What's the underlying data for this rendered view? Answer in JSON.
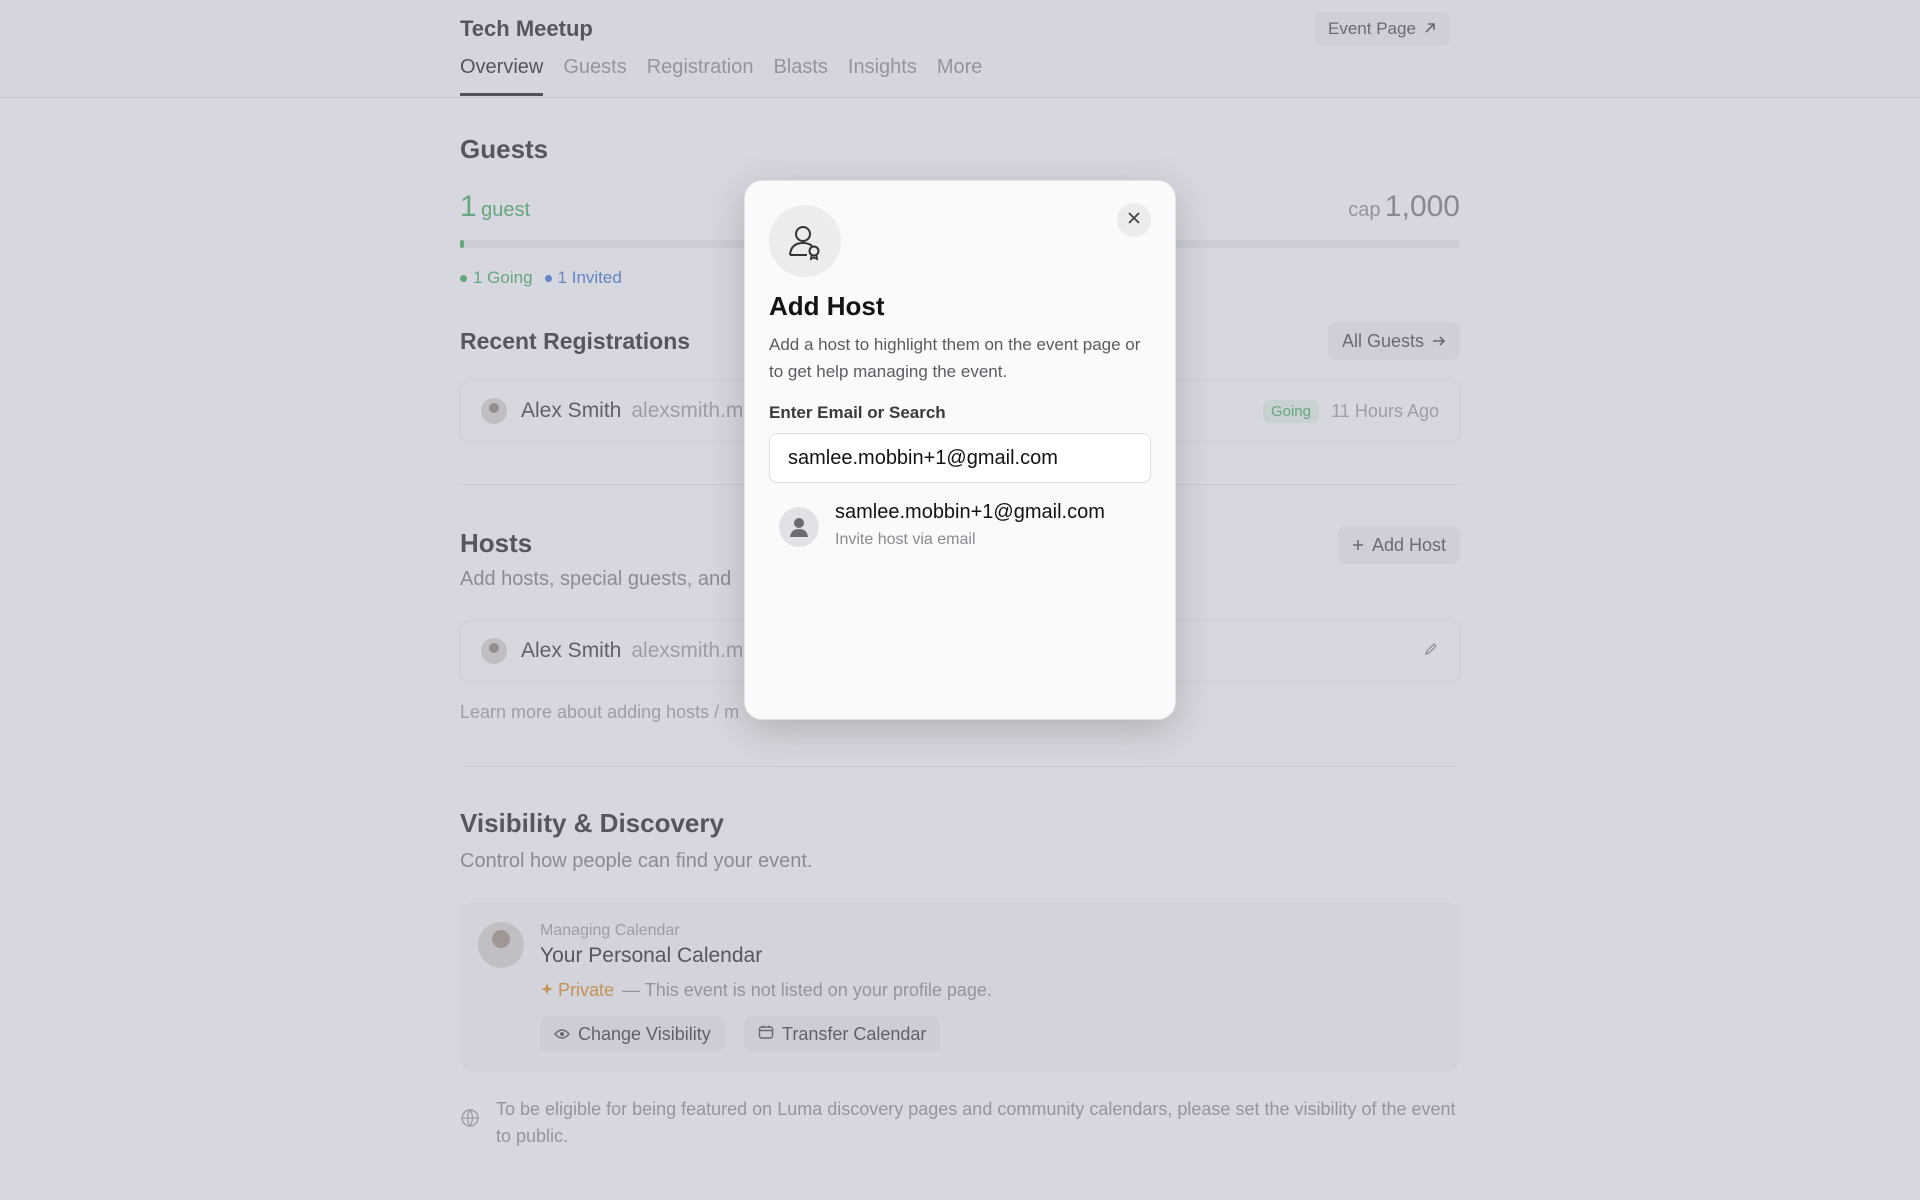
{
  "header": {
    "event_title": "Tech Meetup",
    "event_page_label": "Event Page",
    "tabs": [
      "Overview",
      "Guests",
      "Registration",
      "Blasts",
      "Insights",
      "More"
    ]
  },
  "guests": {
    "heading": "Guests",
    "count": "1",
    "count_label": "guest",
    "cap_label": "cap",
    "cap_value": "1,000",
    "progress_fraction": 0.001,
    "going": "1 Going",
    "invited": "1 Invited"
  },
  "recent": {
    "heading": "Recent Registrations",
    "all_guests_label": "All Guests",
    "row": {
      "name": "Alex Smith",
      "email": "alexsmith.m",
      "status": "Going",
      "time": "11 Hours Ago"
    }
  },
  "hosts": {
    "heading": "Hosts",
    "description": "Add hosts, special guests, and",
    "add_host_label": "Add Host",
    "row": {
      "name": "Alex Smith",
      "email": "alexsmith.m"
    },
    "learn_more": "Learn more about adding hosts / m"
  },
  "visibility": {
    "heading": "Visibility & Discovery",
    "description": "Control how people can find your event.",
    "managing_label": "Managing Calendar",
    "calendar_name": "Your Personal Calendar",
    "private_label": "Private",
    "private_desc": "— This event is not listed on your profile page.",
    "change_visibility_label": "Change Visibility",
    "transfer_calendar_label": "Transfer Calendar",
    "note": "To be eligible for being featured on Luma discovery pages and community calendars, please set the visibility of the event to public."
  },
  "modal": {
    "title": "Add Host",
    "description": "Add a host to highlight them on the event page or to get help managing the event.",
    "field_label": "Enter Email or Search",
    "field_value": "samlee.mobbin+1@gmail.com",
    "suggestion_email": "samlee.mobbin+1@gmail.com",
    "suggestion_sub": "Invite host via email"
  },
  "colors": {
    "accent_green": "#3ea85a",
    "invited_blue": "#3b6fd1",
    "private_orange": "#e08a12"
  }
}
